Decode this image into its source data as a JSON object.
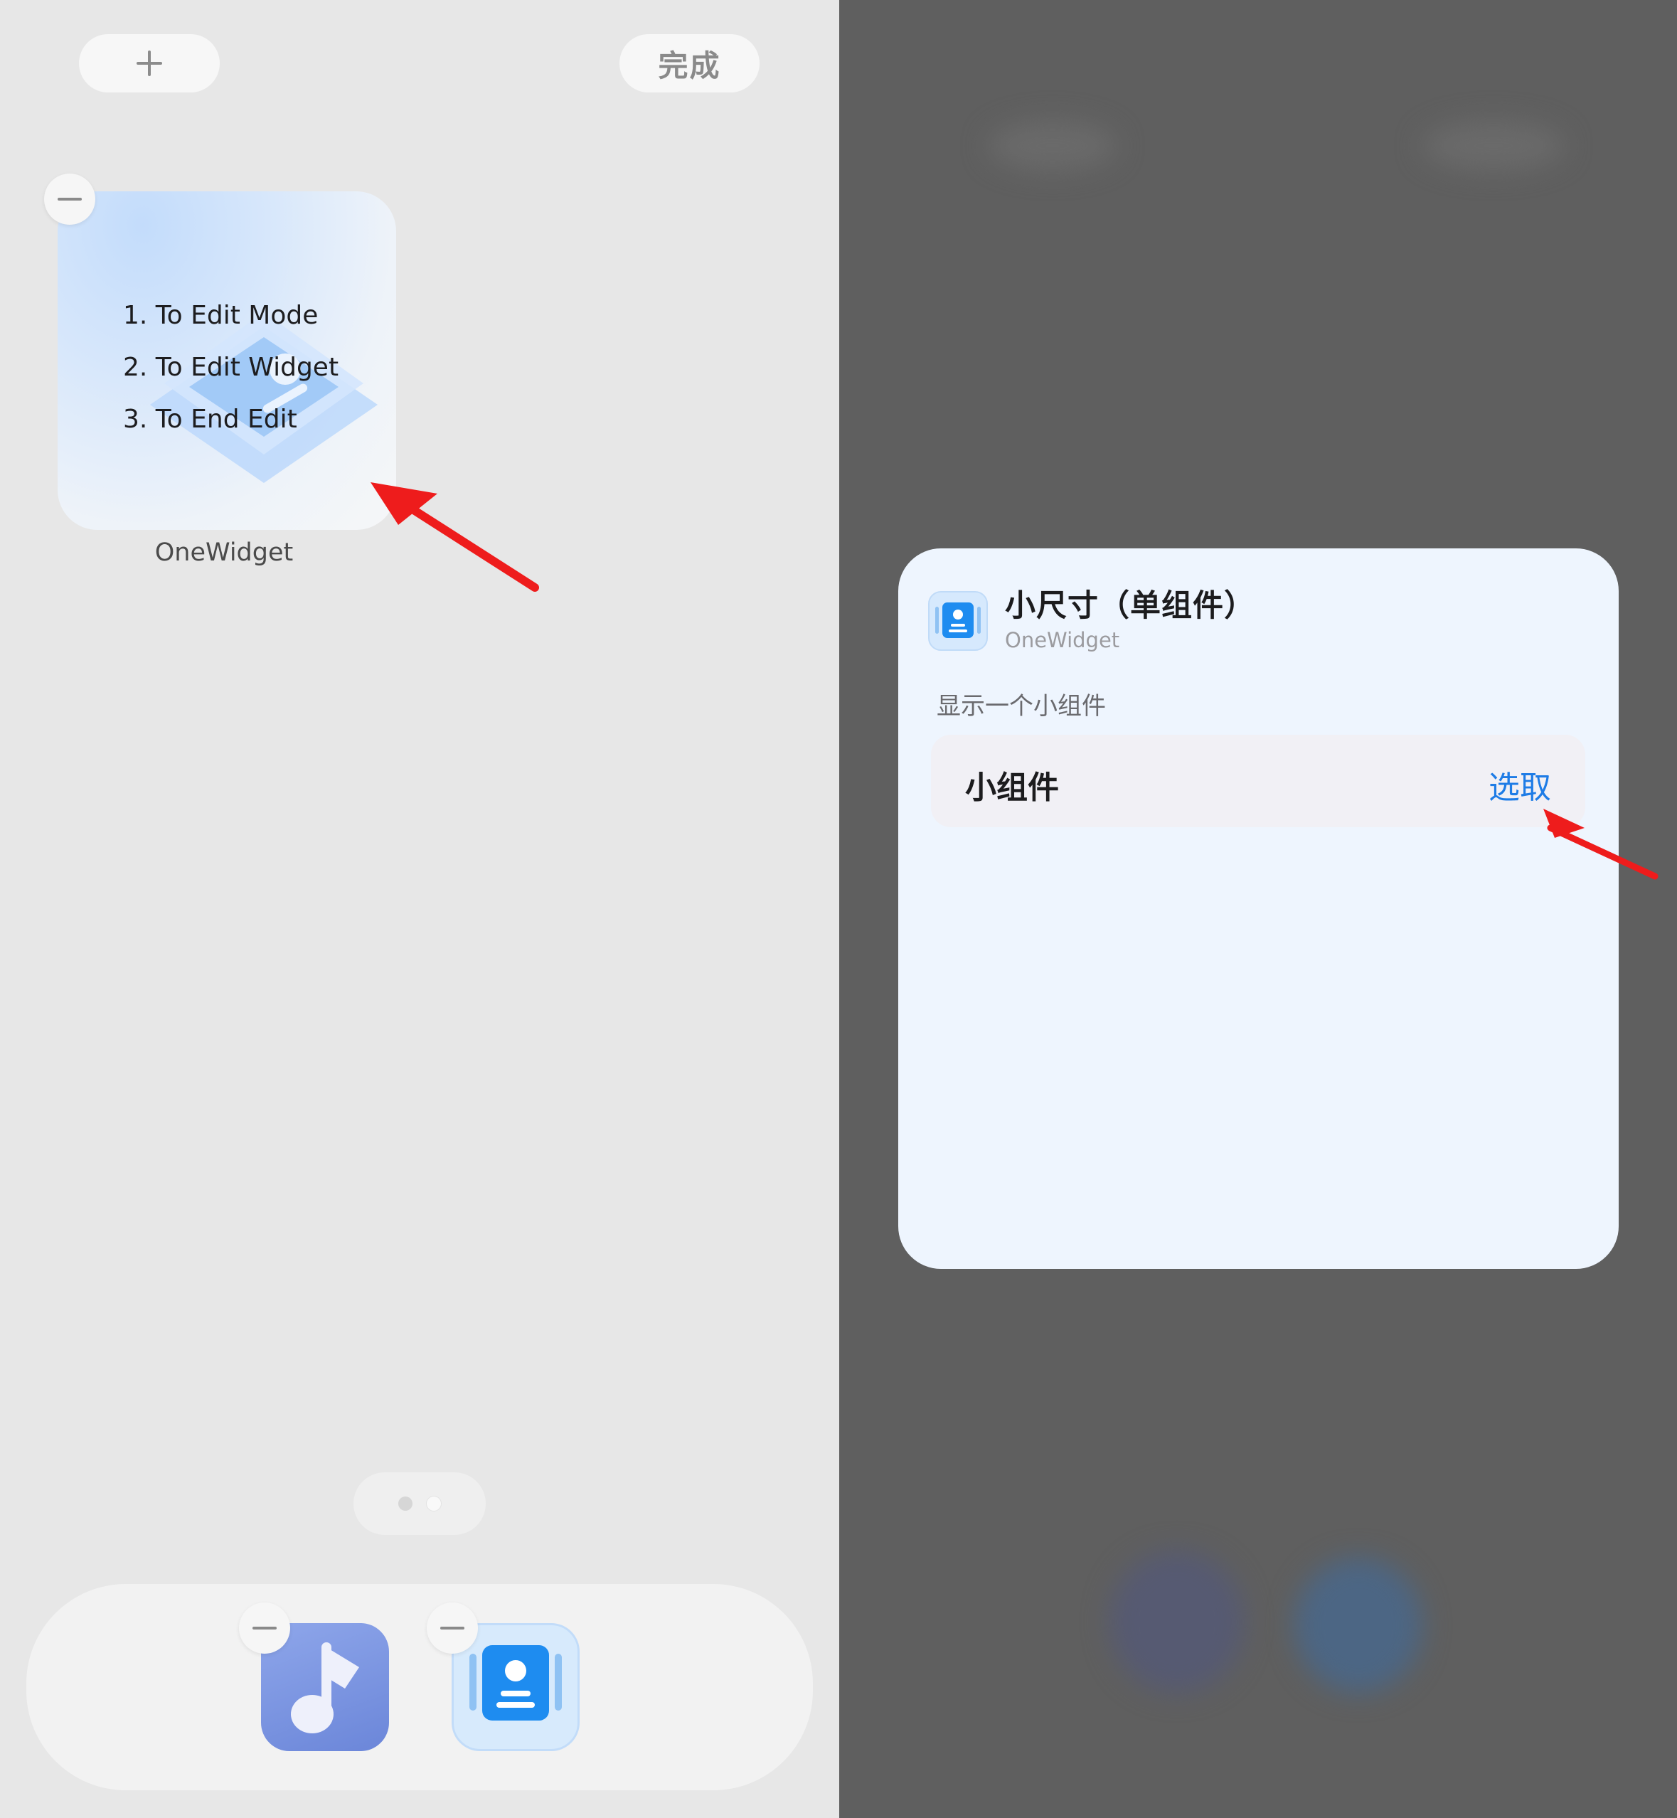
{
  "left": {
    "toolbar": {
      "done_label": "完成"
    },
    "widget": {
      "steps": [
        "1. To Edit Mode",
        "2. To Edit Widget",
        "3. To End Edit"
      ],
      "name": "OneWidget"
    },
    "page_dots": {
      "count": 2,
      "active_index": 1
    },
    "dock": {
      "apps": [
        {
          "icon": "music-note-icon"
        },
        {
          "icon": "contact-card-icon"
        }
      ]
    }
  },
  "right": {
    "sheet": {
      "title": "小尺寸（单组件）",
      "app_name": "OneWidget",
      "description": "显示一个小组件",
      "row": {
        "label": "小组件",
        "action": "选取"
      }
    }
  },
  "colors": {
    "accent_blue": "#1e7ce6",
    "annotation_arrow": "#ee1c1c",
    "overlay_dim": "#5f5f5f"
  }
}
